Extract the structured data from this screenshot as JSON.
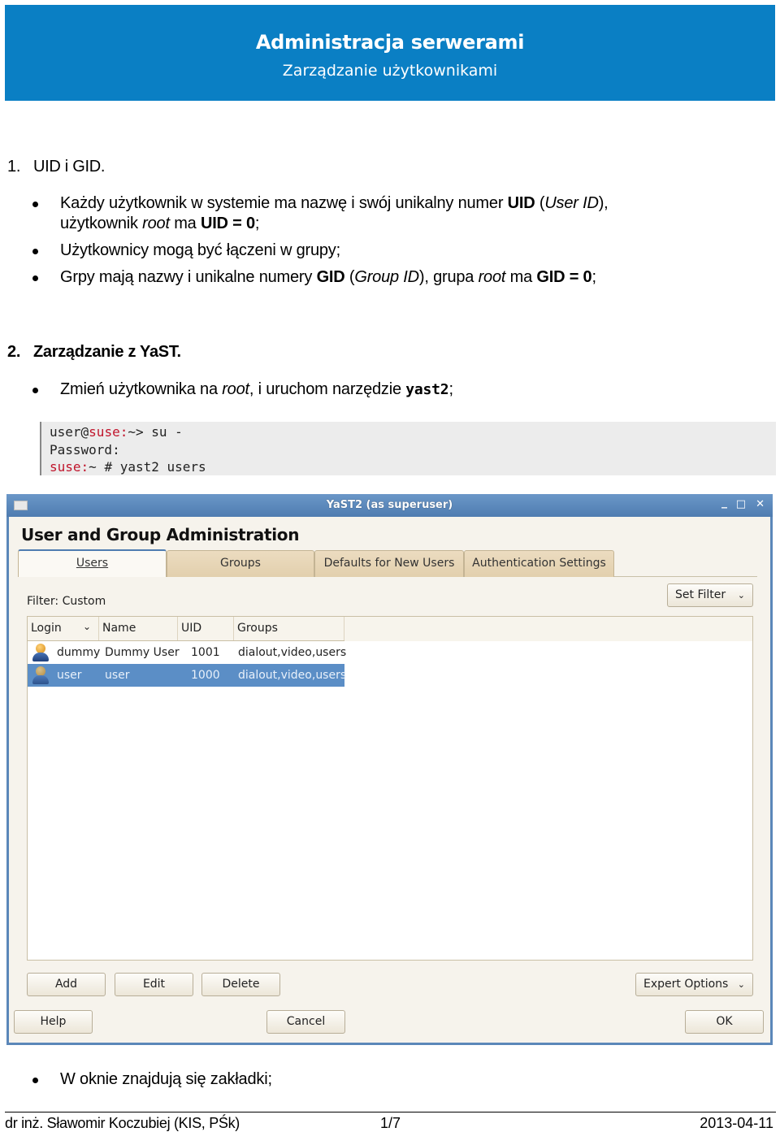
{
  "header": {
    "title": "Administracja serwerami",
    "subtitle": "Zarządzanie użytkownikami"
  },
  "section1": {
    "number": "1.",
    "title": "UID i GID.",
    "bullets": [
      {
        "line1": [
          "Każdy użytkownik w systemie ma nazwę i swój unikalny numer ",
          "UID",
          " (",
          "User ID",
          "),"
        ],
        "line2": [
          "użytkownik ",
          "root",
          " ma ",
          "UID = 0",
          ";"
        ]
      },
      {
        "text": "Użytkownicy mogą być łączeni w grupy;"
      },
      {
        "parts": [
          "Grpy mają nazwy i unikalne numery ",
          "GID",
          " (",
          "Group ID",
          "), grupa ",
          "root",
          " ma ",
          "GID = 0",
          ";"
        ]
      }
    ]
  },
  "section2": {
    "number": "2.",
    "title": "Zarządzanie z YaST.",
    "bullet": [
      "Zmień użytkownika na ",
      "root",
      ", i uruchom narzędzie ",
      "yast2",
      ";"
    ],
    "code": {
      "line1": {
        "user": "user@",
        "host": "suse:",
        "rest": "~> su -"
      },
      "line2": "Password:",
      "line3": {
        "host": "suse:",
        "rest": "~ # yast2 users"
      }
    }
  },
  "yast_window": {
    "window_title": "YaST2 (as superuser)",
    "controls": {
      "minimize": "_",
      "maximize": "□",
      "close": "✕"
    },
    "heading": "User and Group Administration",
    "tabs": [
      {
        "label": "Users",
        "active": true
      },
      {
        "label": "Groups",
        "active": false
      },
      {
        "label": "Defaults for New Users",
        "active": false
      },
      {
        "label": "Authentication Settings",
        "active": false
      }
    ],
    "filter_label": "Filter: Custom",
    "set_filter_button": "Set Filter",
    "table": {
      "columns": [
        "Login",
        "Name",
        "UID",
        "Groups"
      ],
      "sort_indicator": "chevron-down",
      "rows": [
        {
          "login": "dummy",
          "name": "Dummy User",
          "uid": "1001",
          "groups": "dialout,video,users",
          "selected": false
        },
        {
          "login": "user",
          "name": "user",
          "uid": "1000",
          "groups": "dialout,video,users",
          "selected": true
        }
      ]
    },
    "buttons": {
      "add": "Add",
      "edit": "Edit",
      "delete": "Delete",
      "expert_options": "Expert Options",
      "help": "Help",
      "cancel": "Cancel",
      "ok": "OK"
    },
    "colors": {
      "titlebar": "#5b87b9",
      "selection": "#5b8ec6",
      "tab_inactive": "#e6d4b4"
    }
  },
  "section3": {
    "bullet": "W oknie znajdują się zakładki;"
  },
  "footer": {
    "author": "dr inż. Sławomir Koczubiej (KIS, PŚk)",
    "page": "1/7",
    "date": "2013-04-11"
  },
  "colors": {
    "header_bg": "#0a7fc4",
    "code_host": "#c0142b"
  }
}
